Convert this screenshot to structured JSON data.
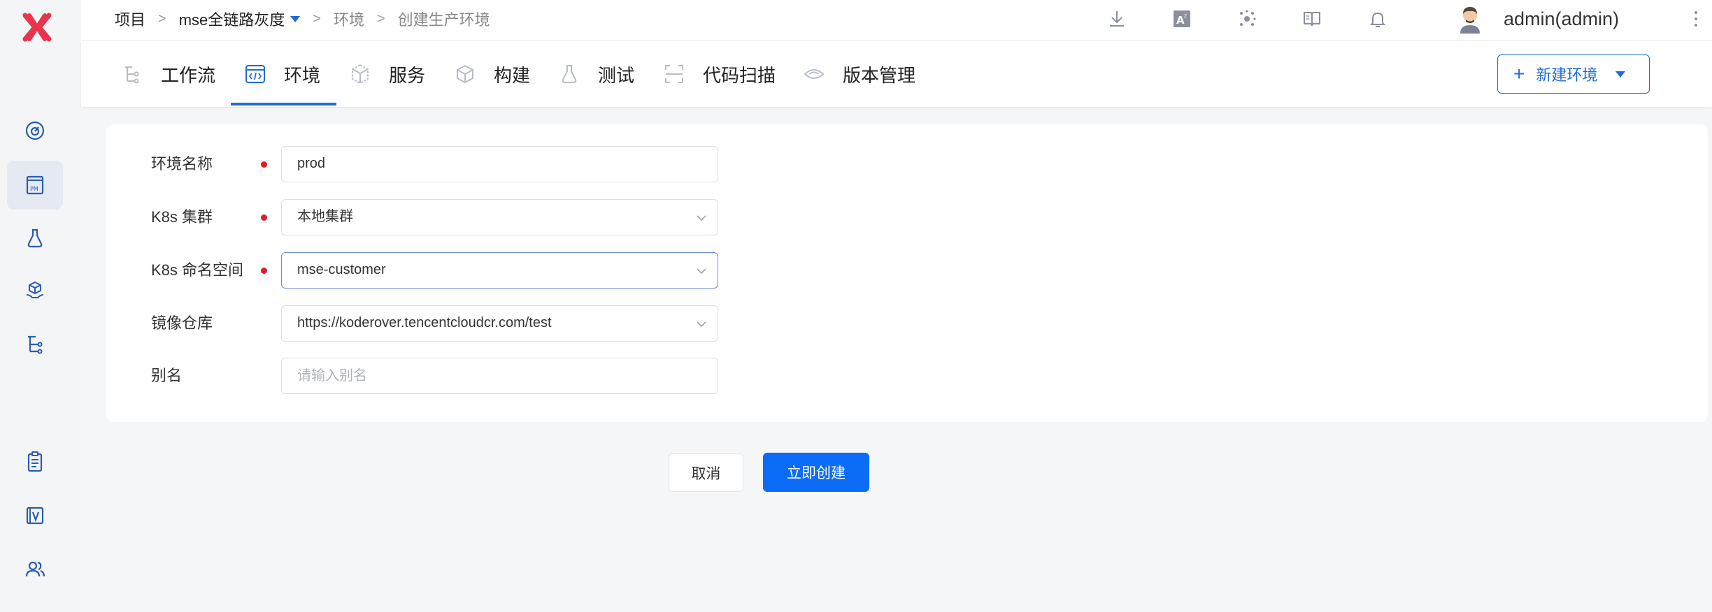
{
  "breadcrumb": {
    "items": [
      "项目",
      "mse全链路灰度",
      "环境",
      "创建生产环境"
    ],
    "separator": ">"
  },
  "header": {
    "user": "admin(admin)",
    "icons": [
      "download-icon",
      "translate-icon",
      "plugin-icon",
      "docs-icon",
      "bell-icon"
    ]
  },
  "tabs": [
    {
      "label": "工作流",
      "icon": "workflow-icon",
      "active": false
    },
    {
      "label": "环境",
      "icon": "code-icon",
      "active": true
    },
    {
      "label": "服务",
      "icon": "cube-icon",
      "active": false
    },
    {
      "label": "构建",
      "icon": "box-icon",
      "active": false
    },
    {
      "label": "测试",
      "icon": "flask-icon",
      "active": false
    },
    {
      "label": "代码扫描",
      "icon": "scan-icon",
      "active": false
    },
    {
      "label": "版本管理",
      "icon": "diamond-icon",
      "active": false
    }
  ],
  "new_env_button": "新建环境",
  "form": {
    "env_name": {
      "label": "环境名称",
      "value": "prod",
      "required": true
    },
    "cluster": {
      "label": "K8s 集群",
      "value": "本地集群",
      "required": true
    },
    "namespace": {
      "label": "K8s 命名空间",
      "value": "mse-customer",
      "required": true
    },
    "registry": {
      "label": "镜像仓库",
      "value": "https://koderover.tencentcloudcr.com/test",
      "required": false
    },
    "alias": {
      "label": "别名",
      "placeholder": "请输入别名",
      "required": false
    }
  },
  "actions": {
    "cancel": "取消",
    "create": "立即创建"
  },
  "colors": {
    "accent": "#1f6bd8",
    "primary_button": "#0b6cf7",
    "required_dot": "#d8202b",
    "logo": "#e8344e"
  }
}
